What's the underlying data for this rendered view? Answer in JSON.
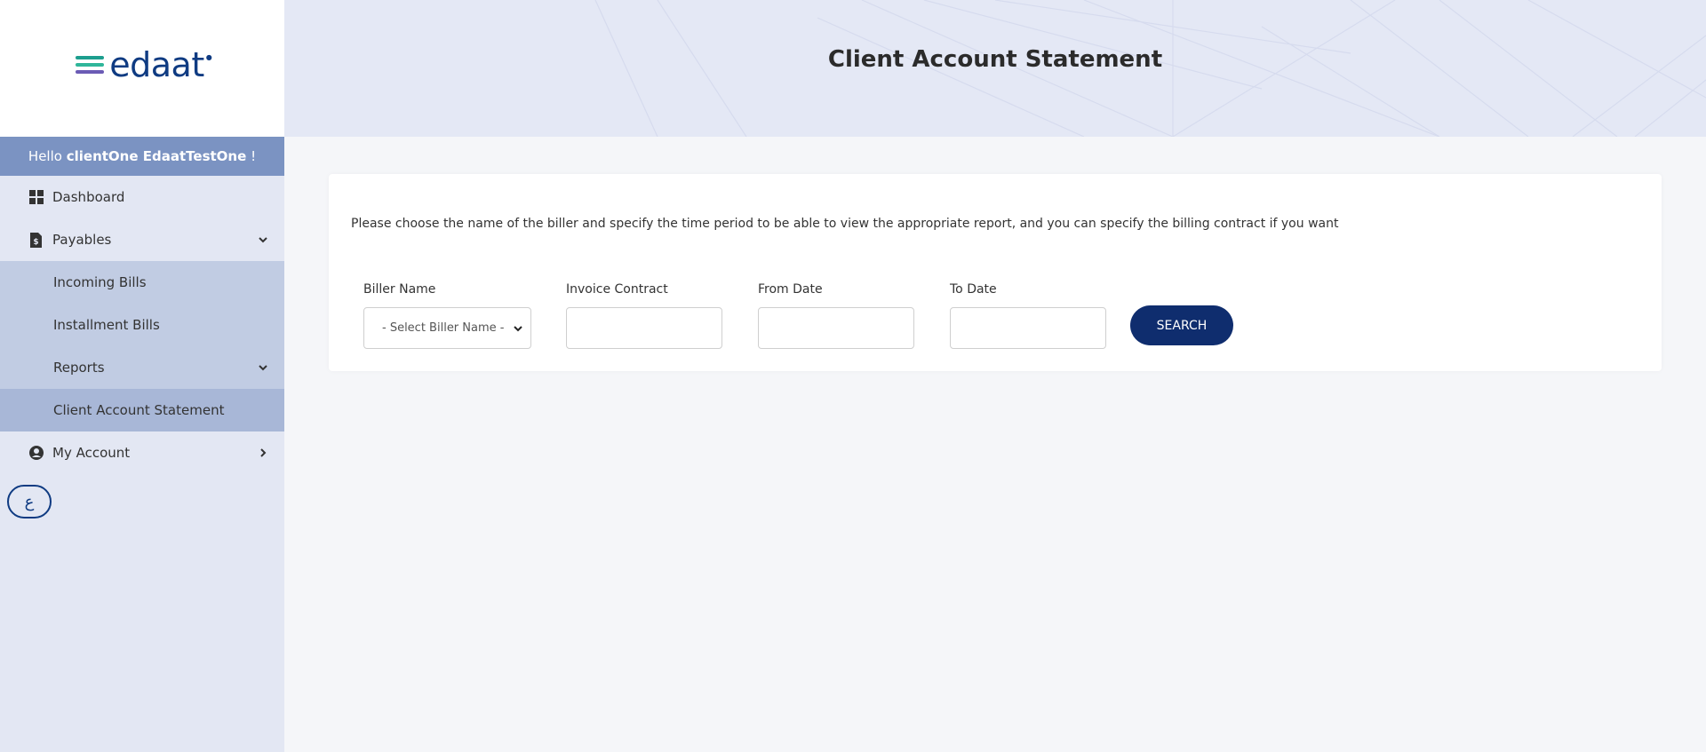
{
  "brand": {
    "logo_text": "edaat",
    "colors": {
      "primary": "#0f3b82",
      "stripe_1": "#1d9e8e",
      "stripe_2": "#2fb69a",
      "stripe_3": "#6b5bb5"
    }
  },
  "sidebar": {
    "greeting_prefix": "Hello",
    "greeting_user": "clientOne EdaatTestOne",
    "greeting_suffix": "!",
    "items": [
      {
        "label": "Dashboard",
        "icon": "dashboard-icon"
      },
      {
        "label": "Payables",
        "icon": "invoice-dollar-icon",
        "expanded": true,
        "children": [
          {
            "label": "Incoming Bills"
          },
          {
            "label": "Installment Bills"
          },
          {
            "label": "Reports",
            "expanded": true
          },
          {
            "label": "Client Account Statement",
            "active": true
          }
        ]
      },
      {
        "label": "My Account",
        "icon": "user-circle-icon"
      }
    ],
    "language_toggle": "ع"
  },
  "header": {
    "title": "Client Account Statement"
  },
  "main": {
    "intro": "Please choose the name of the biller and specify the time period to be able to view the appropriate report, and you can specify the billing contract if you want",
    "fields": {
      "biller_name": {
        "label": "Biller Name",
        "value": "- Select Biller Name -"
      },
      "invoice_contract": {
        "label": "Invoice Contract",
        "value": ""
      },
      "from_date": {
        "label": "From Date",
        "value": ""
      },
      "to_date": {
        "label": "To Date",
        "value": ""
      }
    },
    "search_label": "SEARCH"
  }
}
